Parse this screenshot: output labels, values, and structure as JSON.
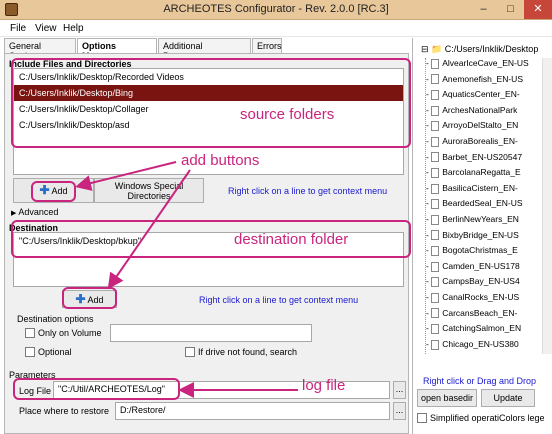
{
  "window": {
    "title": "ARCHEOTES Configurator - Rev. 2.0.0 [RC.3]"
  },
  "menu": [
    "File",
    "View",
    "Help"
  ],
  "tabs": [
    "General Settings",
    "Options Manager",
    "Additional Parameters",
    "Errors"
  ],
  "include": {
    "label": "Include Files and Directories",
    "items": [
      "C:/Users/Inklik/Desktop/Recorded Videos",
      "C:/Users/Inklik/Desktop/Bing",
      "C:/Users/Inklik/Desktop/Collager",
      "C:/Users/Inklik/Desktop/asd"
    ],
    "add_label": "Add",
    "windows_special_label": "Windows Special Directories",
    "hint": "Right click on a line to get context menu",
    "advanced_label": "Advanced"
  },
  "destination": {
    "label": "Destination",
    "value": "\"C:/Users/Inklik/Desktop/bkup\"",
    "add_label": "Add",
    "hint": "Right click on a line to get context menu"
  },
  "destination_options": {
    "label": "Destination options",
    "only_on_volume": "Only on Volume",
    "optional": "Optional",
    "if_drive_not_found": "If drive not found, search"
  },
  "parameters": {
    "label": "Parameters",
    "log_file_label": "Log File",
    "log_file_value": "\"C:/Util/ARCHEOTES/Log\"",
    "restore_label": "Place where to restore",
    "restore_value": "D:/Restore/",
    "browse": "..."
  },
  "annotations": {
    "source_folders": "source folders",
    "add_buttons": "add buttons",
    "destination_folder": "destination folder",
    "log_file": "log file"
  },
  "tree": {
    "root": "C:/Users/Inklik/Desktop",
    "items": [
      "AlvearIceCave_EN-US",
      "Anemonefish_EN-US",
      "AquaticsCenter_EN-",
      "ArchesNationalPark",
      "ArroyoDelStalto_EN",
      "AuroraBorealis_EN-",
      "Barbet_EN-US20547",
      "BarcolanaRegatta_E",
      "BasilicaCistern_EN-",
      "BeardedSeal_EN-US",
      "BerlinNewYears_EN",
      "BixbyBridge_EN-US",
      "BogotaChristmas_E",
      "Camden_EN-US178",
      "CampsBay_EN-US4",
      "CanalRocks_EN-US",
      "CarcansBeach_EN-",
      "CatchingSalmon_EN",
      "Chicago_EN-US380"
    ],
    "hint": "Right click or Drag and Drop",
    "open_basedir": "open basedir",
    "update": "Update",
    "simplified_label": "Simplified operati",
    "colors_label": "Colors lege"
  },
  "colors": {
    "accent": "#c9257e",
    "selection": "#7a1411",
    "hint": "#1a1ad0"
  }
}
